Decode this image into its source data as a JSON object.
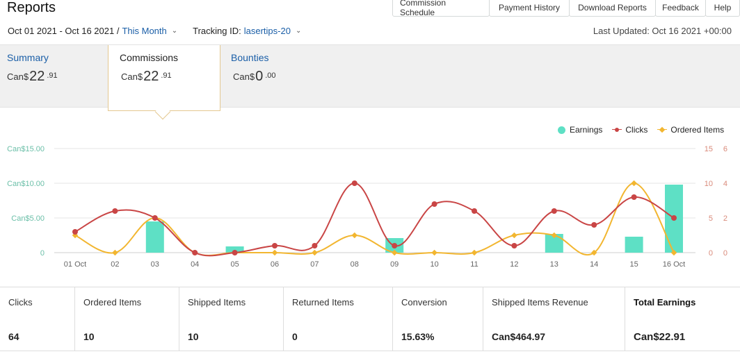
{
  "header": {
    "title": "Reports",
    "nav": [
      "Commission Schedule",
      "Payment History",
      "Download Reports",
      "Feedback",
      "Help"
    ],
    "date_range": "Oct 01 2021 - Oct 16 2021 /",
    "period": "This Month",
    "tracking_label": "Tracking ID:",
    "tracking_id": "lasertips-20",
    "last_updated": "Last Updated: Oct 16 2021 +00:00"
  },
  "tabs": [
    {
      "label": "Summary",
      "currency": "Can$",
      "whole": "22",
      "cents": ".91"
    },
    {
      "label": "Commissions",
      "currency": "Can$",
      "whole": "22",
      "cents": ".91"
    },
    {
      "label": "Bounties",
      "currency": "Can$",
      "whole": "0",
      "cents": ".00"
    }
  ],
  "legend": {
    "earnings": "Earnings",
    "clicks": "Clicks",
    "ordered": "Ordered Items"
  },
  "colors": {
    "earnings": "#5ee0c5",
    "clicks": "#c94545",
    "ordered": "#f2b630",
    "link": "#1a5ea7"
  },
  "chart_data": {
    "type": "bar",
    "categories": [
      "01 Oct",
      "02",
      "03",
      "04",
      "05",
      "06",
      "07",
      "08",
      "09",
      "10",
      "11",
      "12",
      "13",
      "14",
      "15",
      "16 Oct"
    ],
    "left_axis": {
      "ticks": [
        "Can$15.00",
        "Can$10.00",
        "Can$5.00",
        "0"
      ],
      "max": 15
    },
    "right_axis_clicks": {
      "ticks": [
        "15",
        "10",
        "5",
        "0"
      ],
      "max": 15
    },
    "right_axis_ordered": {
      "ticks": [
        "6",
        "4",
        "2",
        "0"
      ],
      "max": 6
    },
    "series": [
      {
        "name": "Earnings",
        "type": "bar",
        "values": [
          0,
          0,
          4.5,
          0,
          0.9,
          0,
          0,
          0,
          2.1,
          0,
          0,
          0,
          2.7,
          0,
          2.3,
          9.8
        ]
      },
      {
        "name": "Clicks",
        "type": "line",
        "values": [
          3,
          6,
          5,
          0,
          0,
          1,
          1,
          10,
          1,
          7,
          6,
          1,
          6,
          4,
          8,
          5
        ]
      },
      {
        "name": "Ordered Items",
        "type": "line",
        "values": [
          1,
          0,
          2,
          0,
          0,
          0,
          0,
          1,
          0,
          0,
          0,
          1,
          1,
          0,
          4,
          0
        ]
      }
    ]
  },
  "stats": [
    {
      "label": "Clicks",
      "value": "64"
    },
    {
      "label": "Ordered Items",
      "value": "10"
    },
    {
      "label": "Shipped Items",
      "value": "10"
    },
    {
      "label": "Returned Items",
      "value": "0"
    },
    {
      "label": "Conversion",
      "value": "15.63%"
    },
    {
      "label": "Shipped Items Revenue",
      "value": "Can$464.97"
    },
    {
      "label": "Total Earnings",
      "value": "Can$22.91"
    }
  ]
}
